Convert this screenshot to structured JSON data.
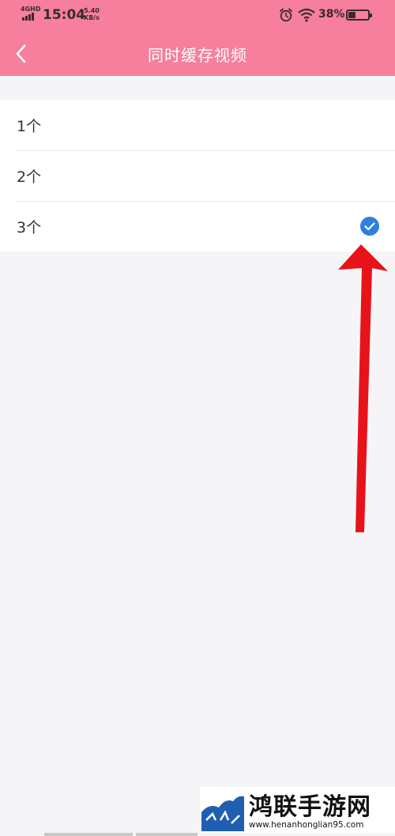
{
  "status_bar": {
    "network": "4GHD",
    "time": "15:04",
    "speed_value": "5.40",
    "speed_unit": "KB/s",
    "battery_percent": "38%",
    "battery_level": 0.38
  },
  "header": {
    "title": "同时缓存视频",
    "back_icon": "chevron-left-icon"
  },
  "options": [
    {
      "label": "1个",
      "selected": false
    },
    {
      "label": "2个",
      "selected": false
    },
    {
      "label": "3个",
      "selected": true
    }
  ],
  "colors": {
    "header_bg": "#f57f9c",
    "check_blue": "#2f7fe0",
    "arrow_red": "#e8121a"
  },
  "watermark": {
    "title": "鸿联手游网",
    "url": "www.henanhonglian95.com"
  }
}
